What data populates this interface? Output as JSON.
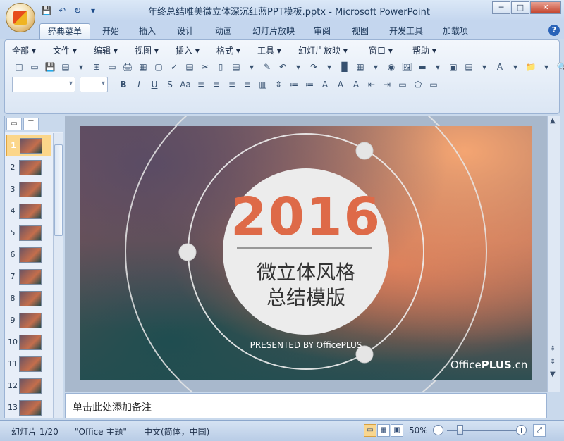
{
  "window": {
    "title": "年终总结唯美微立体深沉红蓝PPT模板.pptx - Microsoft PowerPoint",
    "min": "─",
    "max": "□",
    "close": "✕"
  },
  "qat": {
    "save": "💾",
    "undo": "↶",
    "redo": "↻",
    "more": "▾"
  },
  "tabs": [
    "经典菜单",
    "开始",
    "插入",
    "设计",
    "动画",
    "幻灯片放映",
    "审阅",
    "视图",
    "开发工具",
    "加载项"
  ],
  "help": "?",
  "menus": [
    "全部 ▾",
    "文件 ▾",
    "编辑 ▾",
    "视图 ▾",
    "插入 ▾",
    "格式 ▾",
    "工具 ▾",
    "幻灯片放映 ▾",
    "窗口 ▾",
    "帮助 ▾"
  ],
  "toolbar_icons": [
    "□",
    "▭",
    "💾",
    "▤",
    "▾",
    "⊞",
    "▭",
    "🖨",
    "▦",
    "▢",
    "✓",
    "▤",
    "✂",
    "▯",
    "▤",
    "▾",
    "✎",
    "↶",
    "▾",
    "↷",
    "▾",
    "▉",
    "▦",
    "▾",
    "◉",
    "🖼",
    "▬",
    "▾",
    "▣",
    "▤",
    "▾",
    "A",
    "▾",
    "📁",
    "▾",
    "🔍",
    "▾"
  ],
  "format_buttons": [
    "B",
    "I",
    "U",
    "S",
    "Aa",
    "≡",
    "≡",
    "≡",
    "≡",
    "▥",
    "⇕",
    "≔",
    "≔",
    "A",
    "A",
    "A",
    "⇤",
    "⇥",
    "▭",
    "⬠",
    "▭"
  ],
  "left_panel": {
    "tab_slides": "▭",
    "tab_outline": "☰",
    "slide_numbers": [
      "1",
      "2",
      "3",
      "4",
      "5",
      "6",
      "7",
      "8",
      "9",
      "10",
      "11",
      "12",
      "13"
    ]
  },
  "slide": {
    "year": "2016",
    "title_line1": "微立体风格",
    "title_line2": "总结模版",
    "presented": "PRESENTED BY OfficePLUS",
    "brand_office": "Office",
    "brand_plus": "PLUS",
    "brand_cn": ".cn"
  },
  "notes": {
    "placeholder": "单击此处添加备注"
  },
  "status": {
    "slide_info": "幻灯片 1/20",
    "theme": "\"Office 主题\"",
    "language": "中文(简体，中国)",
    "zoom": "50%",
    "zoom_out": "−",
    "zoom_in": "+"
  },
  "colors": {
    "year_color": "#de6a48",
    "ribbon_bg": "#dbe6f4",
    "accent": "#2a63b8"
  }
}
